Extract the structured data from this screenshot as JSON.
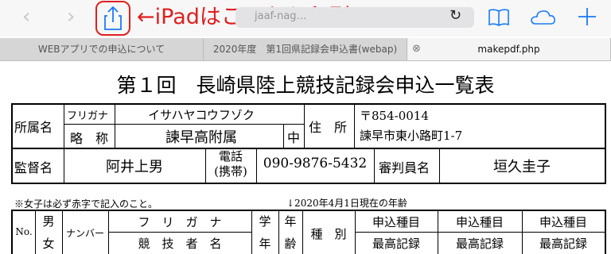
{
  "toolbar": {
    "back_icon": "chevron-left-icon",
    "forward_icon": "chevron-right-icon",
    "annotation": "←iPadはここから印刷",
    "url": "jaaf-nag…",
    "reload_icon": "reload-icon",
    "bookmarks_icon": "book-icon",
    "cloud_icon": "cloud-icon",
    "new_tab_icon": "plus-icon"
  },
  "tabs": [
    {
      "label": "WEBアプリでの申込について"
    },
    {
      "label": "2020年度　第1回県記録会申込書(webap)"
    },
    {
      "label": "makepdf.php"
    }
  ],
  "doc": {
    "title": "第１回　長崎県陸上競技記録会申込一覧表",
    "affiliation_label": "所属名",
    "furigana_label": "フリガナ",
    "furigana_value": "イサハヤコウフゾク",
    "abbrev_label": "略　称",
    "abbrev_value": "諫早高附属",
    "school_level": "中",
    "address_label": "住　所",
    "postal": "〒854-0014",
    "address": "諫早市東小路町1-7",
    "supervisor_label": "監督名",
    "supervisor_value": "阿井上男",
    "phone_label_1": "電話",
    "phone_label_2": "(携帯)",
    "phone_value": "090-9876-5432",
    "referee_label": "審判員名",
    "referee_value": "垣久圭子",
    "note_left": "※女子は必ず赤字で記入のこと。",
    "note_right": "↓2020年4月1日現在の年齢",
    "h_no": "No.",
    "h_male": "男",
    "h_female": "女",
    "h_number": "ナンバー",
    "h_furigana": "フ　リ　ガ　ナ",
    "h_name": "競　技　者　名",
    "h_grade_1": "学",
    "h_grade_2": "年",
    "h_age_1": "年",
    "h_age_2": "齢",
    "h_category": "種　別",
    "h_event_1": "申込種目",
    "h_record_1": "最高記録",
    "h_event_2": "申込種目",
    "h_record_2": "最高記録",
    "h_event_3": "申込種目",
    "h_record_3": "最高記録"
  }
}
